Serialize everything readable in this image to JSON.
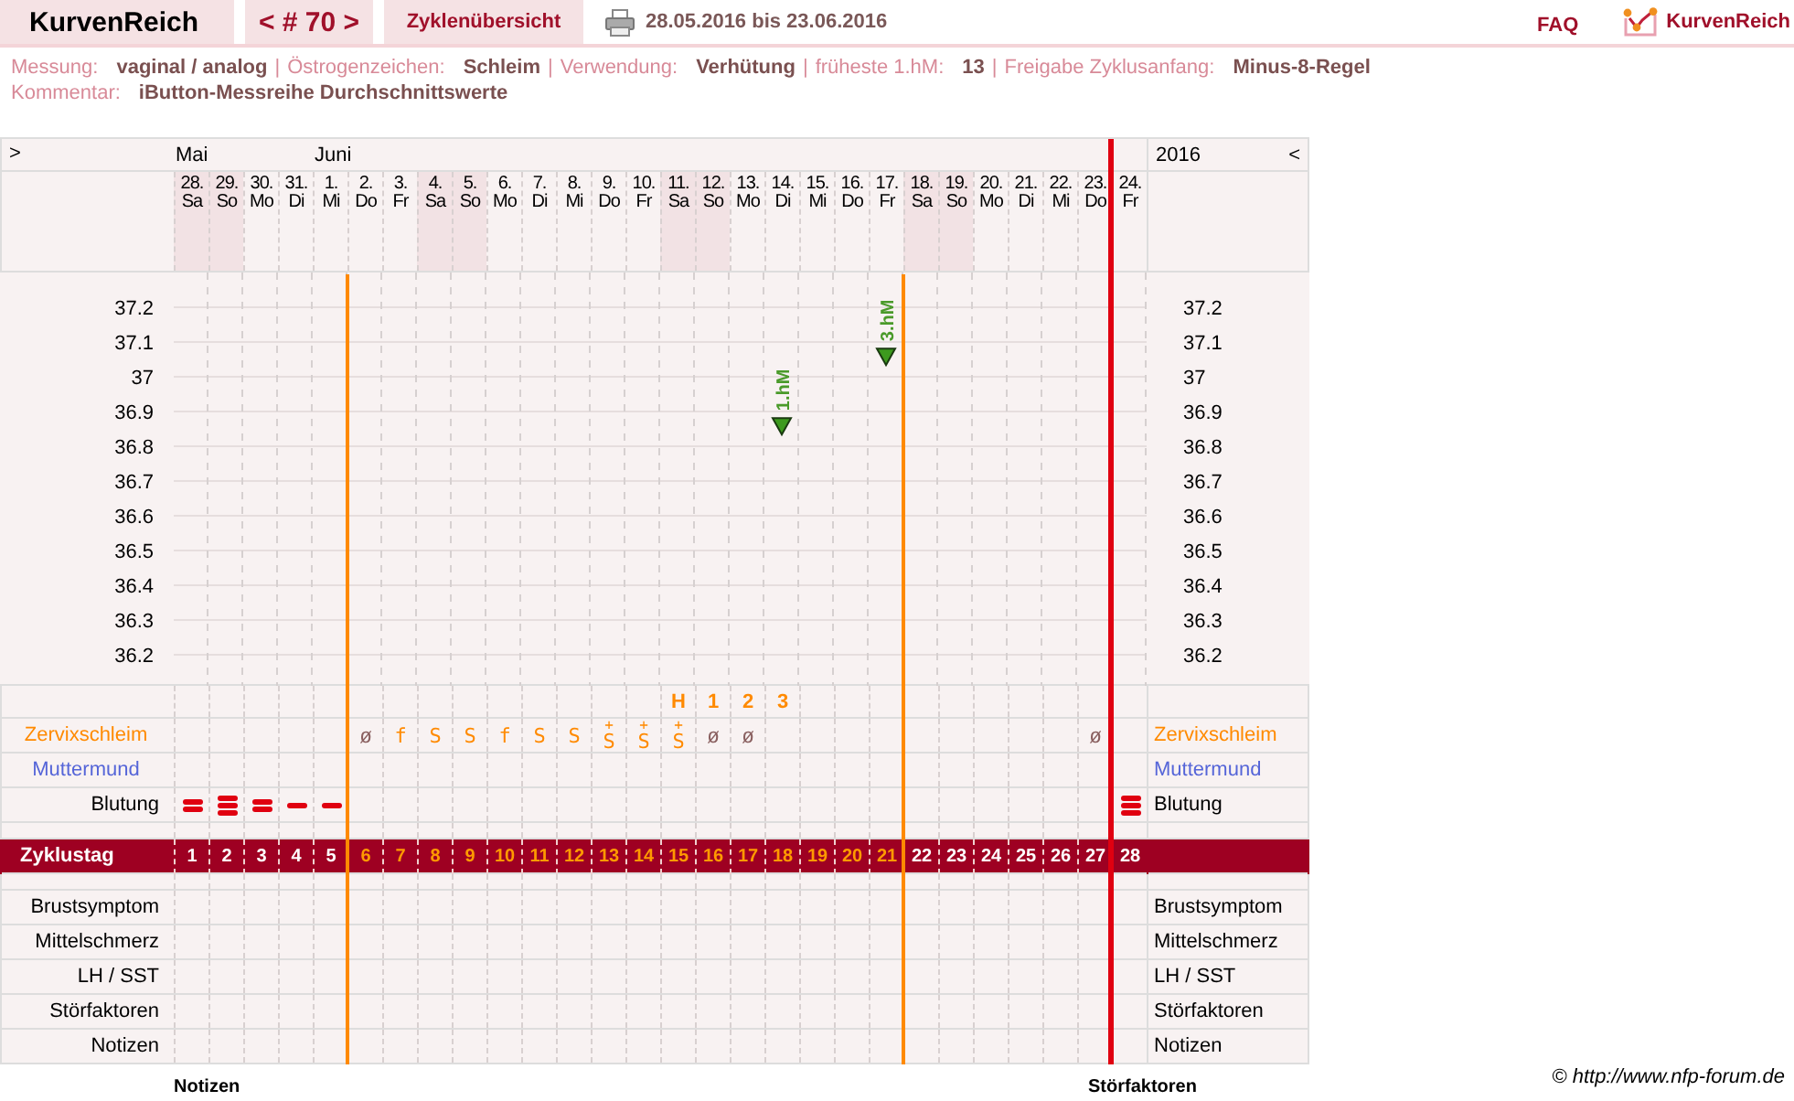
{
  "header": {
    "brand": "KurvenReich",
    "cycle_nav": "< # 70 >",
    "overview": "Zyklenübersicht",
    "date_range": "28.05.2016 bis 23.06.2016",
    "faq": "FAQ",
    "logo_text": "KurvenReich"
  },
  "info_lines": [
    [
      {
        "label": "Messung:",
        "value": "vaginal / analog"
      },
      {
        "sep": "|",
        "label": "Östrogenzeichen:",
        "value": "Schleim"
      },
      {
        "sep": "|",
        "label": "Verwendung:",
        "value": "Verhütung"
      },
      {
        "sep": "|",
        "label": "früheste 1.hM:",
        "value": "13"
      },
      {
        "sep": "|",
        "label": "Freigabe Zyklusanfang:",
        "value": "Minus-8-Regel"
      }
    ],
    [
      {
        "label": "Kommentar:",
        "value": "iButton-Messreihe Durchschnittswerte"
      }
    ]
  ],
  "grid": {
    "prev": ">",
    "year": "2016",
    "next": "<",
    "cycle_day_label": "Zyklustag",
    "chart_data": {
      "type": "scatter",
      "values": [
        null,
        null,
        null,
        null,
        null,
        null,
        null,
        null,
        null,
        null,
        null,
        null,
        null,
        null,
        null,
        null,
        null,
        36.86,
        null,
        null,
        37.06,
        null,
        null,
        null,
        null,
        null,
        null,
        null
      ],
      "ylim": [
        36.1,
        37.3
      ],
      "yticks": [
        36.2,
        36.3,
        36.4,
        36.5,
        36.6,
        36.7,
        36.8,
        36.9,
        37,
        37.1,
        37.2
      ],
      "grid": true,
      "annotations": [
        "1.hM",
        "3.hM"
      ]
    },
    "right_axis_labels": [
      "37.2",
      "37.1",
      "37",
      "36.9",
      "36.8",
      "36.7",
      "36.6",
      "36.5",
      "36.4",
      "36.3",
      "36.2"
    ],
    "days": [
      {
        "date": "28.",
        "weekday": "Sa",
        "weekend": true,
        "month": "Mai",
        "cycle_day": "1",
        "in_window": false,
        "bleeding": {
          "kind": "medium"
        }
      },
      {
        "date": "29.",
        "weekday": "So",
        "weekend": true,
        "cycle_day": "2",
        "in_window": false,
        "bleeding": {
          "kind": "heavy"
        }
      },
      {
        "date": "30.",
        "weekday": "Mo",
        "weekend": false,
        "cycle_day": "3",
        "in_window": false,
        "bleeding": {
          "kind": "medium"
        }
      },
      {
        "date": "31.",
        "weekday": "Di",
        "weekend": false,
        "cycle_day": "4",
        "in_window": false,
        "bleeding": {
          "kind": "light"
        }
      },
      {
        "date": "1.",
        "weekday": "Mi",
        "weekend": false,
        "month": "Juni",
        "cycle_day": "5",
        "in_window": false,
        "bleeding": {
          "kind": "light"
        }
      },
      {
        "date": "2.",
        "weekday": "Do",
        "weekend": false,
        "cycle_day": "6",
        "in_window": true,
        "mucus": {
          "symbol": "ø",
          "kind": "dry"
        }
      },
      {
        "date": "3.",
        "weekday": "Fr",
        "weekend": false,
        "cycle_day": "7",
        "in_window": true,
        "mucus": {
          "symbol": "f",
          "kind": "fertile"
        }
      },
      {
        "date": "4.",
        "weekday": "Sa",
        "weekend": true,
        "cycle_day": "8",
        "in_window": true,
        "mucus": {
          "symbol": "S",
          "kind": "fertile"
        }
      },
      {
        "date": "5.",
        "weekday": "So",
        "weekend": true,
        "cycle_day": "9",
        "in_window": true,
        "mucus": {
          "symbol": "S",
          "kind": "fertile"
        }
      },
      {
        "date": "6.",
        "weekday": "Mo",
        "weekend": false,
        "cycle_day": "10",
        "in_window": true,
        "mucus": {
          "symbol": "f",
          "kind": "fertile"
        }
      },
      {
        "date": "7.",
        "weekday": "Di",
        "weekend": false,
        "cycle_day": "11",
        "in_window": true,
        "mucus": {
          "symbol": "S",
          "kind": "fertile"
        }
      },
      {
        "date": "8.",
        "weekday": "Mi",
        "weekend": false,
        "cycle_day": "12",
        "in_window": true,
        "mucus": {
          "symbol": "S",
          "kind": "fertile"
        }
      },
      {
        "date": "9.",
        "weekday": "Do",
        "weekend": false,
        "cycle_day": "13",
        "in_window": true,
        "mucus": {
          "mark": "+",
          "symbol": "S",
          "kind": "fertile"
        }
      },
      {
        "date": "10.",
        "weekday": "Fr",
        "weekend": false,
        "cycle_day": "14",
        "in_window": true,
        "mucus": {
          "mark": "+",
          "symbol": "S",
          "kind": "fertile"
        }
      },
      {
        "date": "11.",
        "weekday": "Sa",
        "weekend": true,
        "cycle_day": "15",
        "in_window": true,
        "peak": "H",
        "mucus": {
          "mark": "+",
          "symbol": "S",
          "kind": "fertile"
        }
      },
      {
        "date": "12.",
        "weekday": "So",
        "weekend": true,
        "cycle_day": "16",
        "in_window": true,
        "peak": "1",
        "mucus": {
          "symbol": "ø",
          "kind": "dry"
        }
      },
      {
        "date": "13.",
        "weekday": "Mo",
        "weekend": false,
        "cycle_day": "17",
        "in_window": true,
        "peak": "2",
        "mucus": {
          "symbol": "ø",
          "kind": "dry"
        }
      },
      {
        "date": "14.",
        "weekday": "Di",
        "weekend": false,
        "cycle_day": "18",
        "in_window": true,
        "peak": "3"
      },
      {
        "date": "15.",
        "weekday": "Mi",
        "weekend": false,
        "cycle_day": "19",
        "in_window": true
      },
      {
        "date": "16.",
        "weekday": "Do",
        "weekend": false,
        "cycle_day": "20",
        "in_window": true
      },
      {
        "date": "17.",
        "weekday": "Fr",
        "weekend": false,
        "cycle_day": "21",
        "in_window": true
      },
      {
        "date": "18.",
        "weekday": "Sa",
        "weekend": true,
        "cycle_day": "22",
        "in_window": false
      },
      {
        "date": "19.",
        "weekday": "So",
        "weekend": true,
        "cycle_day": "23",
        "in_window": false
      },
      {
        "date": "20.",
        "weekday": "Mo",
        "weekend": false,
        "cycle_day": "24",
        "in_window": false
      },
      {
        "date": "21.",
        "weekday": "Di",
        "weekend": false,
        "cycle_day": "25",
        "in_window": false
      },
      {
        "date": "22.",
        "weekday": "Mi",
        "weekend": false,
        "cycle_day": "26",
        "in_window": false
      },
      {
        "date": "23.",
        "weekday": "Do",
        "weekend": false,
        "cycle_day": "27",
        "in_window": false,
        "mucus": {
          "symbol": "ø",
          "kind": "dry"
        }
      },
      {
        "date": "24.",
        "weekday": "Fr",
        "weekend": false,
        "cycle_day": "28",
        "in_window": false,
        "cycle_start": true,
        "bleeding": {
          "kind": "heavy"
        }
      }
    ],
    "sign_rows": [
      {
        "kind": "mucus",
        "label": "Zervixschleim",
        "label_right": "Zervixschleim"
      },
      {
        "kind": "cervix",
        "label": "Muttermund",
        "label_right": "Muttermund"
      },
      {
        "kind": "bleeding",
        "label": "Blutung",
        "label_right": "Blutung"
      }
    ],
    "extra_rows": [
      {
        "label": "Brustsymptom",
        "label_right": "Brustsymptom"
      },
      {
        "label": "Mittelschmerz",
        "label_right": "Mittelschmerz"
      },
      {
        "label": "LH / SST",
        "label_right": "LH / SST"
      },
      {
        "label": "Störfaktoren",
        "label_right": "Störfaktoren"
      },
      {
        "label": "Notizen",
        "label_right": "Notizen"
      }
    ]
  },
  "footer": {
    "section_left": "Notizen",
    "section_right": "Störfaktoren",
    "copyright": "© http://www.nfp-forum.de"
  }
}
